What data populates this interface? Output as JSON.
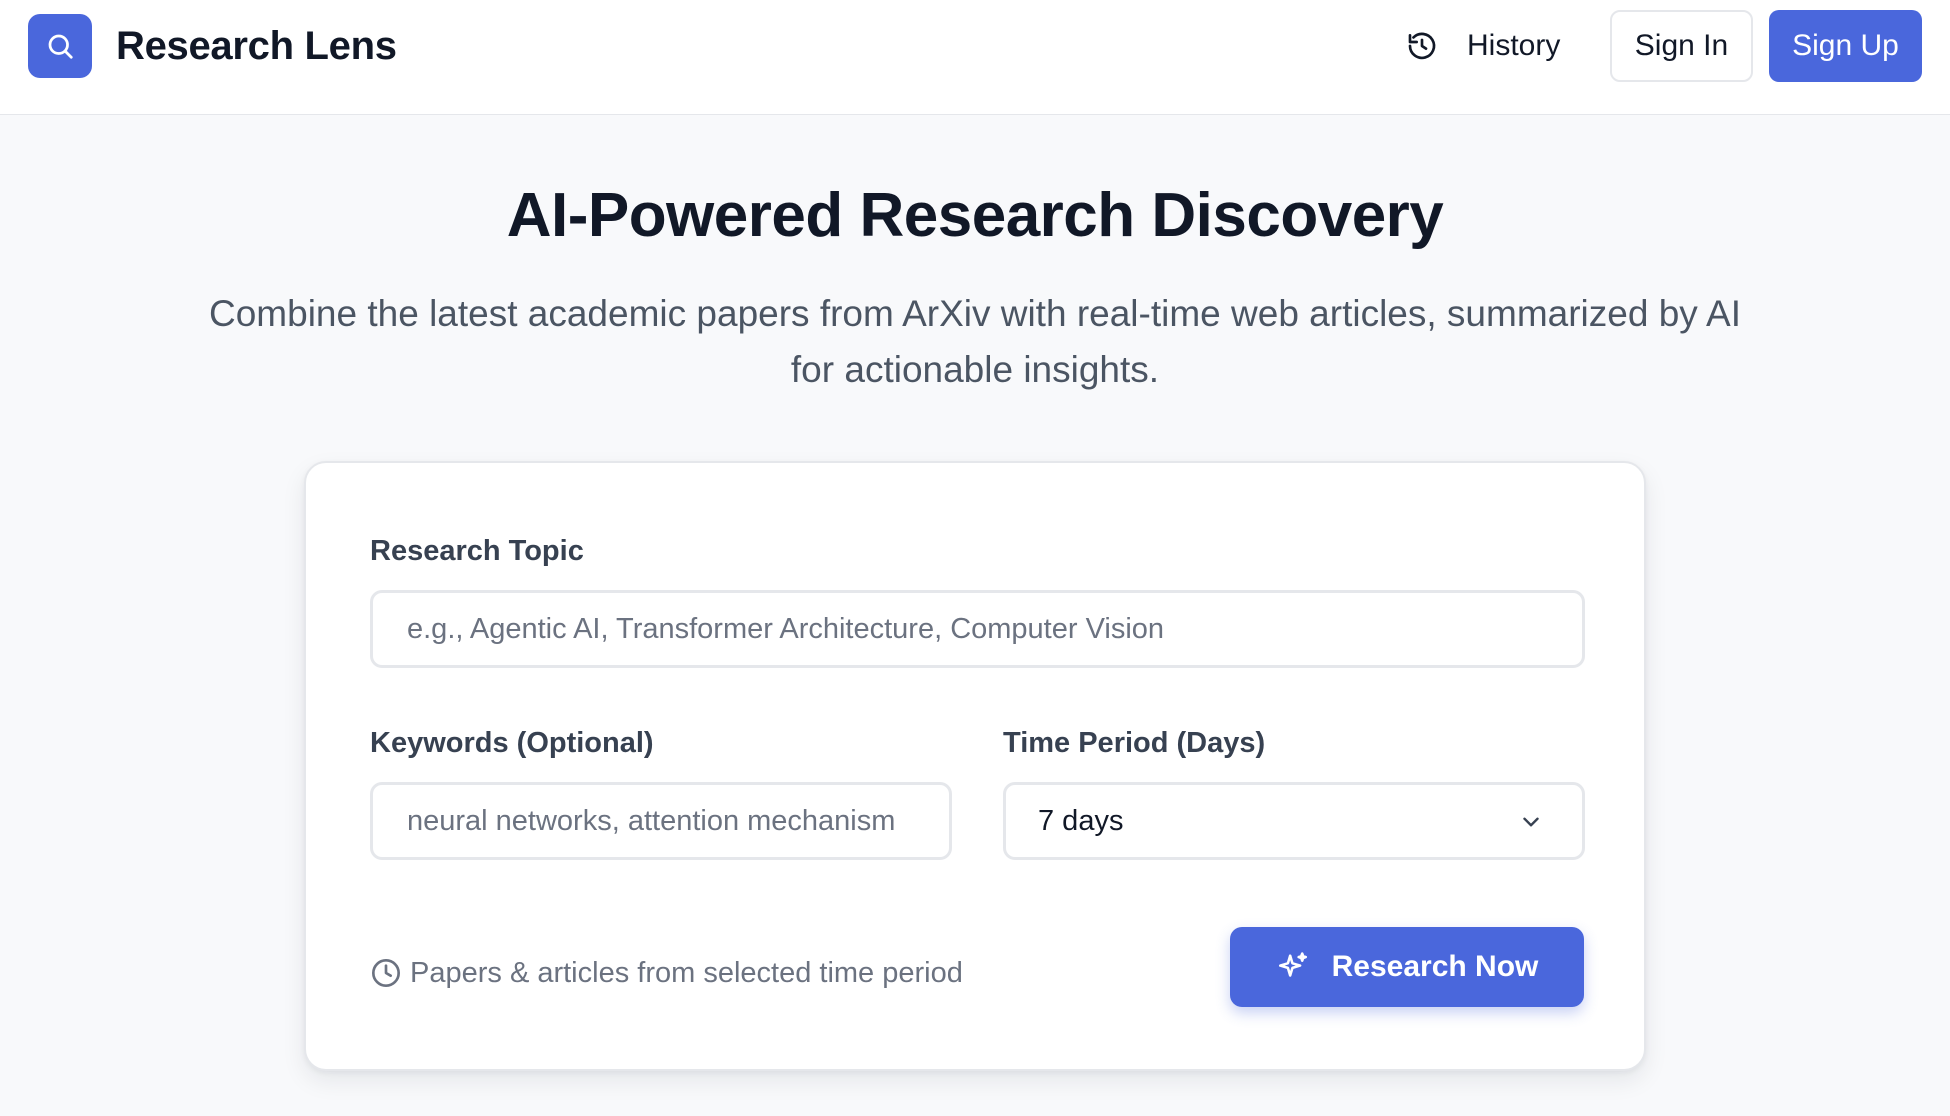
{
  "app": {
    "name": "Research Lens",
    "logo_icon": "search-icon"
  },
  "header": {
    "history_label": "History",
    "history_icon": "history-icon",
    "sign_in_label": "Sign In",
    "sign_up_label": "Sign Up"
  },
  "hero": {
    "title": "AI-Powered Research Discovery",
    "subtitle": "Combine the latest academic papers from ArXiv with real-time web articles, summarized by AI for actionable insights."
  },
  "form": {
    "topic": {
      "label": "Research Topic",
      "value": "",
      "placeholder": "e.g., Agentic AI, Transformer Architecture, Computer Vision"
    },
    "keywords": {
      "label": "Keywords (Optional)",
      "value": "",
      "placeholder": "neural networks, attention mechanism"
    },
    "time_period": {
      "label": "Time Period (Days)",
      "selected": "7 days",
      "icon": "chevron-down-icon"
    },
    "helper_text": "Papers & articles from selected time period",
    "helper_icon": "clock-icon",
    "submit_label": "Research Now",
    "submit_icon": "sparkles-icon"
  },
  "colors": {
    "accent": "#4a67dc",
    "page_bg": "#f8f9fb",
    "border": "#e5e7eb",
    "text_primary": "#111827",
    "text_secondary": "#4b5563",
    "text_muted": "#6b7280"
  }
}
